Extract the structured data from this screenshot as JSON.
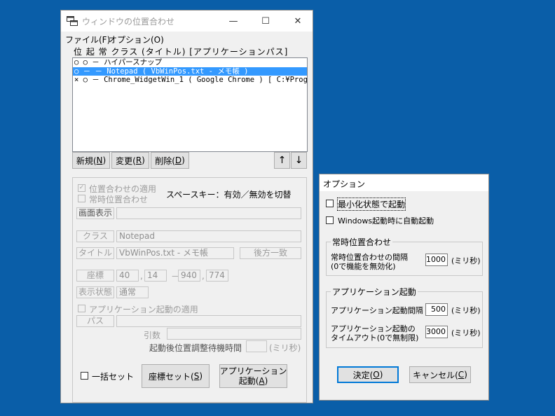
{
  "main": {
    "title": "ウィンドウの位置合わせ",
    "caption": {
      "minimize": "—",
      "maximize": "☐",
      "close": "✕"
    },
    "menu": [
      "ファイル(F)",
      "オプション(O)"
    ],
    "column_header": "位 起 常 クラス (タイトル) [アプリケーションパス]",
    "list_rows": [
      "○ ○ － ハイパースナップ",
      "○ － － Notepad ( VbWinPos.txt - メモ帳 )",
      "× ○ － Chrome_WidgetWin_1 ( Google Chrome ) [ C:¥Prog"
    ],
    "selected_index": 1,
    "buttons": {
      "new_a": "新規(",
      "new_u": "N",
      "new_b": ")",
      "edit_a": "変更(",
      "edit_u": "R",
      "edit_b": ")",
      "del_a": "削除(",
      "del_u": "D",
      "del_b": ")",
      "up": "↑",
      "down": "↓"
    },
    "detail": {
      "apply_pos_label": "位置合わせの適用",
      "always_pos_label": "常時位置合わせ",
      "space_hint": "スペースキー：有効／無効を切替",
      "screen_label": "画面表示",
      "class_label": "クラス",
      "class_value": "Notepad",
      "title_label": "タイトル",
      "title_value": "VbWinPos.txt - メモ帳",
      "match_button": "後方一致",
      "coord_label": "座標",
      "coords": [
        "40",
        "14",
        "940",
        "774"
      ],
      "coord_sep": "－",
      "state_label": "表示状態",
      "state_value": "通常",
      "app_launch_label": "アプリケーション起動の適用",
      "path_label": "パス",
      "args_label": "引数",
      "wait_label": "起動後位置調整待機時間",
      "wait_unit": "(ミリ秒)"
    },
    "bottom": {
      "batch_label": "一括セット",
      "coord_set_a": "座標セット(",
      "coord_set_u": "S",
      "coord_set_b": ")",
      "launch_line1": "アプリケーション",
      "launch_line2a": "起動(",
      "launch_line2u": "A",
      "launch_line2b": ")"
    }
  },
  "options": {
    "title": "オプション",
    "minimize_launch": "最小化状態で起動",
    "windows_start": "Windows起動時に自動起動",
    "always_group": "常時位置合わせ",
    "interval_line1": "常時位置合わせの間隔",
    "interval_line2": "(0で機能を無効化)",
    "interval_value": "1000",
    "unit": "(ミリ秒)",
    "app_group": "アプリケーション起動",
    "launch_interval_label": "アプリケーション起動間隔",
    "launch_interval_value": "500",
    "timeout_line1": "アプリケーション起動の",
    "timeout_line2": "タイムアウト(0で無制限)",
    "timeout_value": "3000",
    "ok_a": "決定(",
    "ok_u": "O",
    "ok_b": ")",
    "cancel_a": "キャンセル(",
    "cancel_u": "C",
    "cancel_b": ")"
  }
}
